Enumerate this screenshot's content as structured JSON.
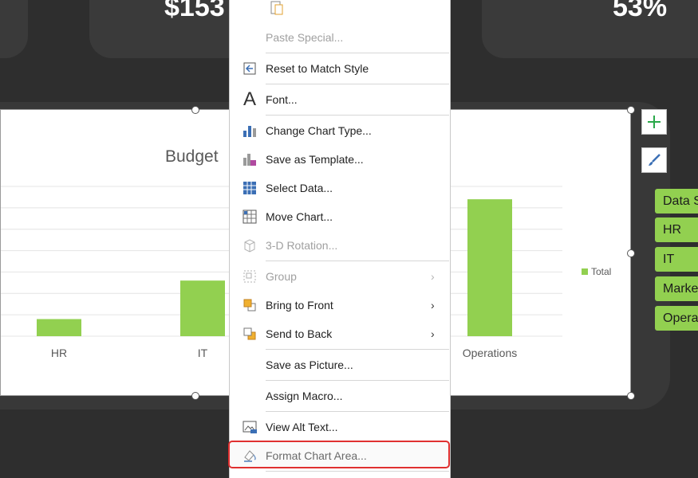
{
  "kpis": {
    "left": "$153",
    "right": "53%"
  },
  "chart_data": {
    "type": "bar",
    "title": "Budget",
    "categories": [
      "HR",
      "IT",
      "Operations"
    ],
    "series": [
      {
        "name": "Total",
        "values": [
          8,
          26,
          64
        ]
      }
    ],
    "ylim": [
      0,
      70
    ],
    "grid": true,
    "legend": "right"
  },
  "chart": {
    "title": "Budget",
    "categories": [
      "HR",
      "IT",
      "Operations"
    ],
    "legend_label": "Total",
    "bar_color": "#92d050"
  },
  "slicer": {
    "items": [
      "Data S",
      "HR",
      "IT",
      "Marke",
      "Opera"
    ]
  },
  "menu": {
    "items": [
      {
        "label": "Paste Special...",
        "disabled": true
      },
      {
        "label": "Reset to Match Style"
      },
      {
        "label": "Font..."
      },
      {
        "label": "Change Chart Type..."
      },
      {
        "label": "Save as Template..."
      },
      {
        "label": "Select Data..."
      },
      {
        "label": "Move Chart..."
      },
      {
        "label": "3-D Rotation...",
        "disabled": true
      },
      {
        "label": "Group",
        "disabled": true,
        "submenu": true
      },
      {
        "label": "Bring to Front",
        "submenu": true
      },
      {
        "label": "Send to Back",
        "submenu": true
      },
      {
        "label": "Save as Picture..."
      },
      {
        "label": "Assign Macro..."
      },
      {
        "label": "View Alt Text..."
      },
      {
        "label": "Format Chart Area...",
        "highlighted": true
      }
    ],
    "submenu_arrow": "›"
  },
  "icons": {
    "add": "plus-icon",
    "style": "brush-icon"
  }
}
